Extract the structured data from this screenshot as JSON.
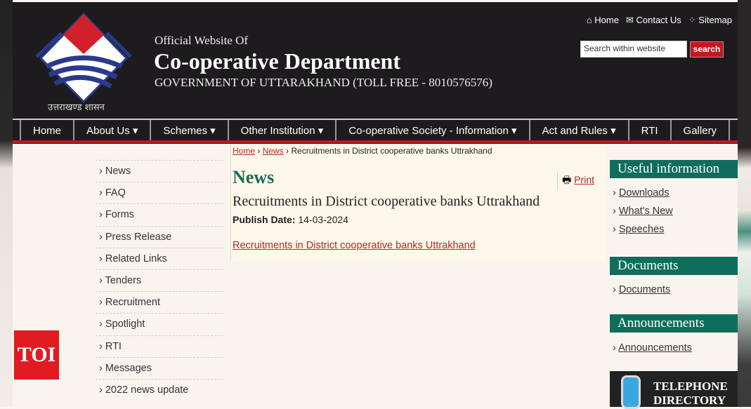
{
  "header": {
    "hindi": "उत्तराखण्ड शासन",
    "subtitle": "Official Website Of",
    "title": "Co-operative Department",
    "gov": "GOVERNMENT OF UTTARAKHAND (TOLL FREE - 8010576576)",
    "toplinks": [
      "⌂ Home",
      "✉ Contact Us",
      "⁘ Sitemap"
    ],
    "search_placeholder": "Search within website",
    "search_button": "search"
  },
  "nav": [
    "Home",
    "About Us ▾",
    "Schemes ▾",
    "Other Institution ▾",
    "Co-operative Society - Information ▾",
    "Act and Rules ▾",
    "RTI",
    "Gallery"
  ],
  "sidebar": [
    "› News",
    "› FAQ",
    "› Forms",
    "› Press Release",
    "› Related Links",
    "› Tenders",
    "› Recruitment",
    "› Spotlight",
    "› RTI",
    "› Messages",
    "› 2022 news update"
  ],
  "breadcrumb": {
    "home": "Home",
    "news": "News",
    "current": "Recruitments in District cooperative banks Uttrakhand",
    "sep": " › "
  },
  "main": {
    "heading": "News",
    "print": "Print",
    "title": "Recruitments in District cooperative banks Uttrakhand",
    "publish_label": "Publish Date:",
    "publish_date": "14-03-2024",
    "link": "Recruitments in District cooperative banks Uttrakhand"
  },
  "right": {
    "useful": "Useful information",
    "useful_items": [
      "Downloads",
      "What's New",
      "Speeches"
    ],
    "documents": "Documents",
    "documents_items": [
      "Documents"
    ],
    "announcements": "Announcements",
    "announcements_items": [
      "Announcements"
    ],
    "telephone": "TELEPHONE DIRECTORY"
  },
  "watermark": "TOI",
  "colors": {
    "accent": "#0f6d5c",
    "nav_bar": "#b71c1c",
    "header_bg": "#1d1b1d",
    "link": "#b22a2a"
  }
}
